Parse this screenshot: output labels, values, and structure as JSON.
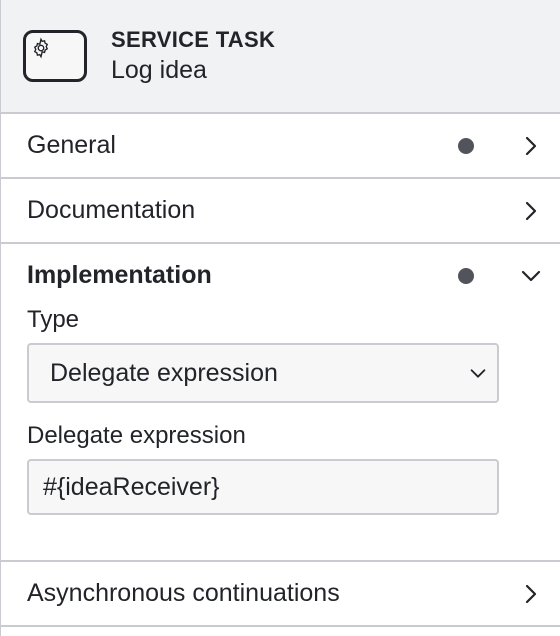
{
  "header": {
    "element_type": "SERVICE TASK",
    "element_name": "Log idea",
    "icon": "gear-icon"
  },
  "groups": [
    {
      "label": "General",
      "has_data": true,
      "expanded": false
    },
    {
      "label": "Documentation",
      "has_data": false,
      "expanded": false
    },
    {
      "label": "Implementation",
      "has_data": true,
      "expanded": true
    },
    {
      "label": "Asynchronous continuations",
      "has_data": false,
      "expanded": false
    }
  ],
  "implementation": {
    "type_label": "Type",
    "type_value": "Delegate expression",
    "delegate_label": "Delegate expression",
    "delegate_value": "#{ideaReceiver}"
  },
  "colors": {
    "header_bg": "#f1f2f4",
    "border": "#c9cbd1",
    "text": "#22242a",
    "dot": "#52545c",
    "input_bg": "#f7f7f8"
  }
}
